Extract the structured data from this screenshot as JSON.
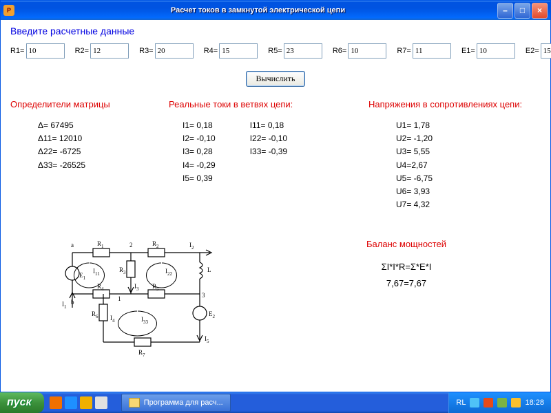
{
  "window": {
    "app_icon": "P",
    "title": "Расчет токов в замкнутой электрической цепи"
  },
  "form": {
    "legend": "Введите  расчетные данные",
    "fields": {
      "R1": {
        "label": "R1=",
        "value": "10"
      },
      "R2": {
        "label": "R2=",
        "value": "12"
      },
      "R3": {
        "label": "R3=",
        "value": "20"
      },
      "R4": {
        "label": "R4=",
        "value": "15"
      },
      "R5": {
        "label": "R5=",
        "value": "23"
      },
      "R6": {
        "label": "R6=",
        "value": "10"
      },
      "R7": {
        "label": "R7=",
        "value": "11"
      },
      "E1": {
        "label": "E1=",
        "value": "10"
      },
      "E2": {
        "label": "E2=",
        "value": "15"
      }
    },
    "calc_button": "Вычислить"
  },
  "results": {
    "determinants": {
      "title": "Определители матрицы",
      "items": [
        "Δ= 67495",
        "Δ11= 12010",
        "Δ22= -6725",
        "Δ33= -26525"
      ]
    },
    "currents": {
      "title": "Реальные токи в ветвях цепи:",
      "left": [
        "I1= 0,18",
        "I2= -0,10",
        "I3= 0,28",
        "I4= -0,29",
        "I5= 0,39"
      ],
      "right": [
        "I11= 0,18",
        "I22= -0,10",
        "I33= -0,39"
      ]
    },
    "voltages": {
      "title": "Напряжения в сопротивлениях цепи:",
      "items": [
        "U1= 1,78",
        "U2= -1,20",
        "U3= 5,55",
        "U4=2,67",
        "U5= -6,75",
        "U6= 3,93",
        "U7= 4,32"
      ]
    },
    "balance": {
      "title": "Баланс мощностей",
      "eq1": "ΣI*I*R=Σ*E*I",
      "eq2": "7,67=7,67"
    }
  },
  "circuit": {
    "labels": {
      "R1": "R",
      "R1s": "1",
      "R2": "R",
      "R2s": "2",
      "R3": "R",
      "R3s": "3",
      "R4": "R",
      "R4s": "4",
      "R5": "R",
      "R5s": "5",
      "R6": "R",
      "R6s": "6",
      "R7": "R",
      "R7s": "7",
      "E1": "E",
      "E1s": "1",
      "E2": "E",
      "E2s": "2",
      "L": "L",
      "I1": "I",
      "I1s": "1",
      "I2": "I",
      "I2s": "2",
      "I3": "I",
      "I3s": "3",
      "I5": "I",
      "I5s": "5",
      "I11": "I",
      "I11s": "11",
      "I22": "I",
      "I22s": "22",
      "I33": "I",
      "I33s": "33",
      "I4": "I",
      "I4s": "4",
      "n1": "1",
      "n2": "2",
      "n3": "3",
      "a": "a",
      "b": "b"
    }
  },
  "taskbar": {
    "start": "пуск",
    "task1": "Программа для расч...",
    "lang": "RL",
    "clock": "18:28"
  },
  "icons": {
    "ql1": "#f07000",
    "ql2": "#1e90ff",
    "ql3": "#f0b000",
    "ql4": "#e0e0e0",
    "tray1": "#4fc3f7",
    "tray2": "#e64a19",
    "tray3": "#7cb342",
    "tray4": "#fbc02d"
  }
}
